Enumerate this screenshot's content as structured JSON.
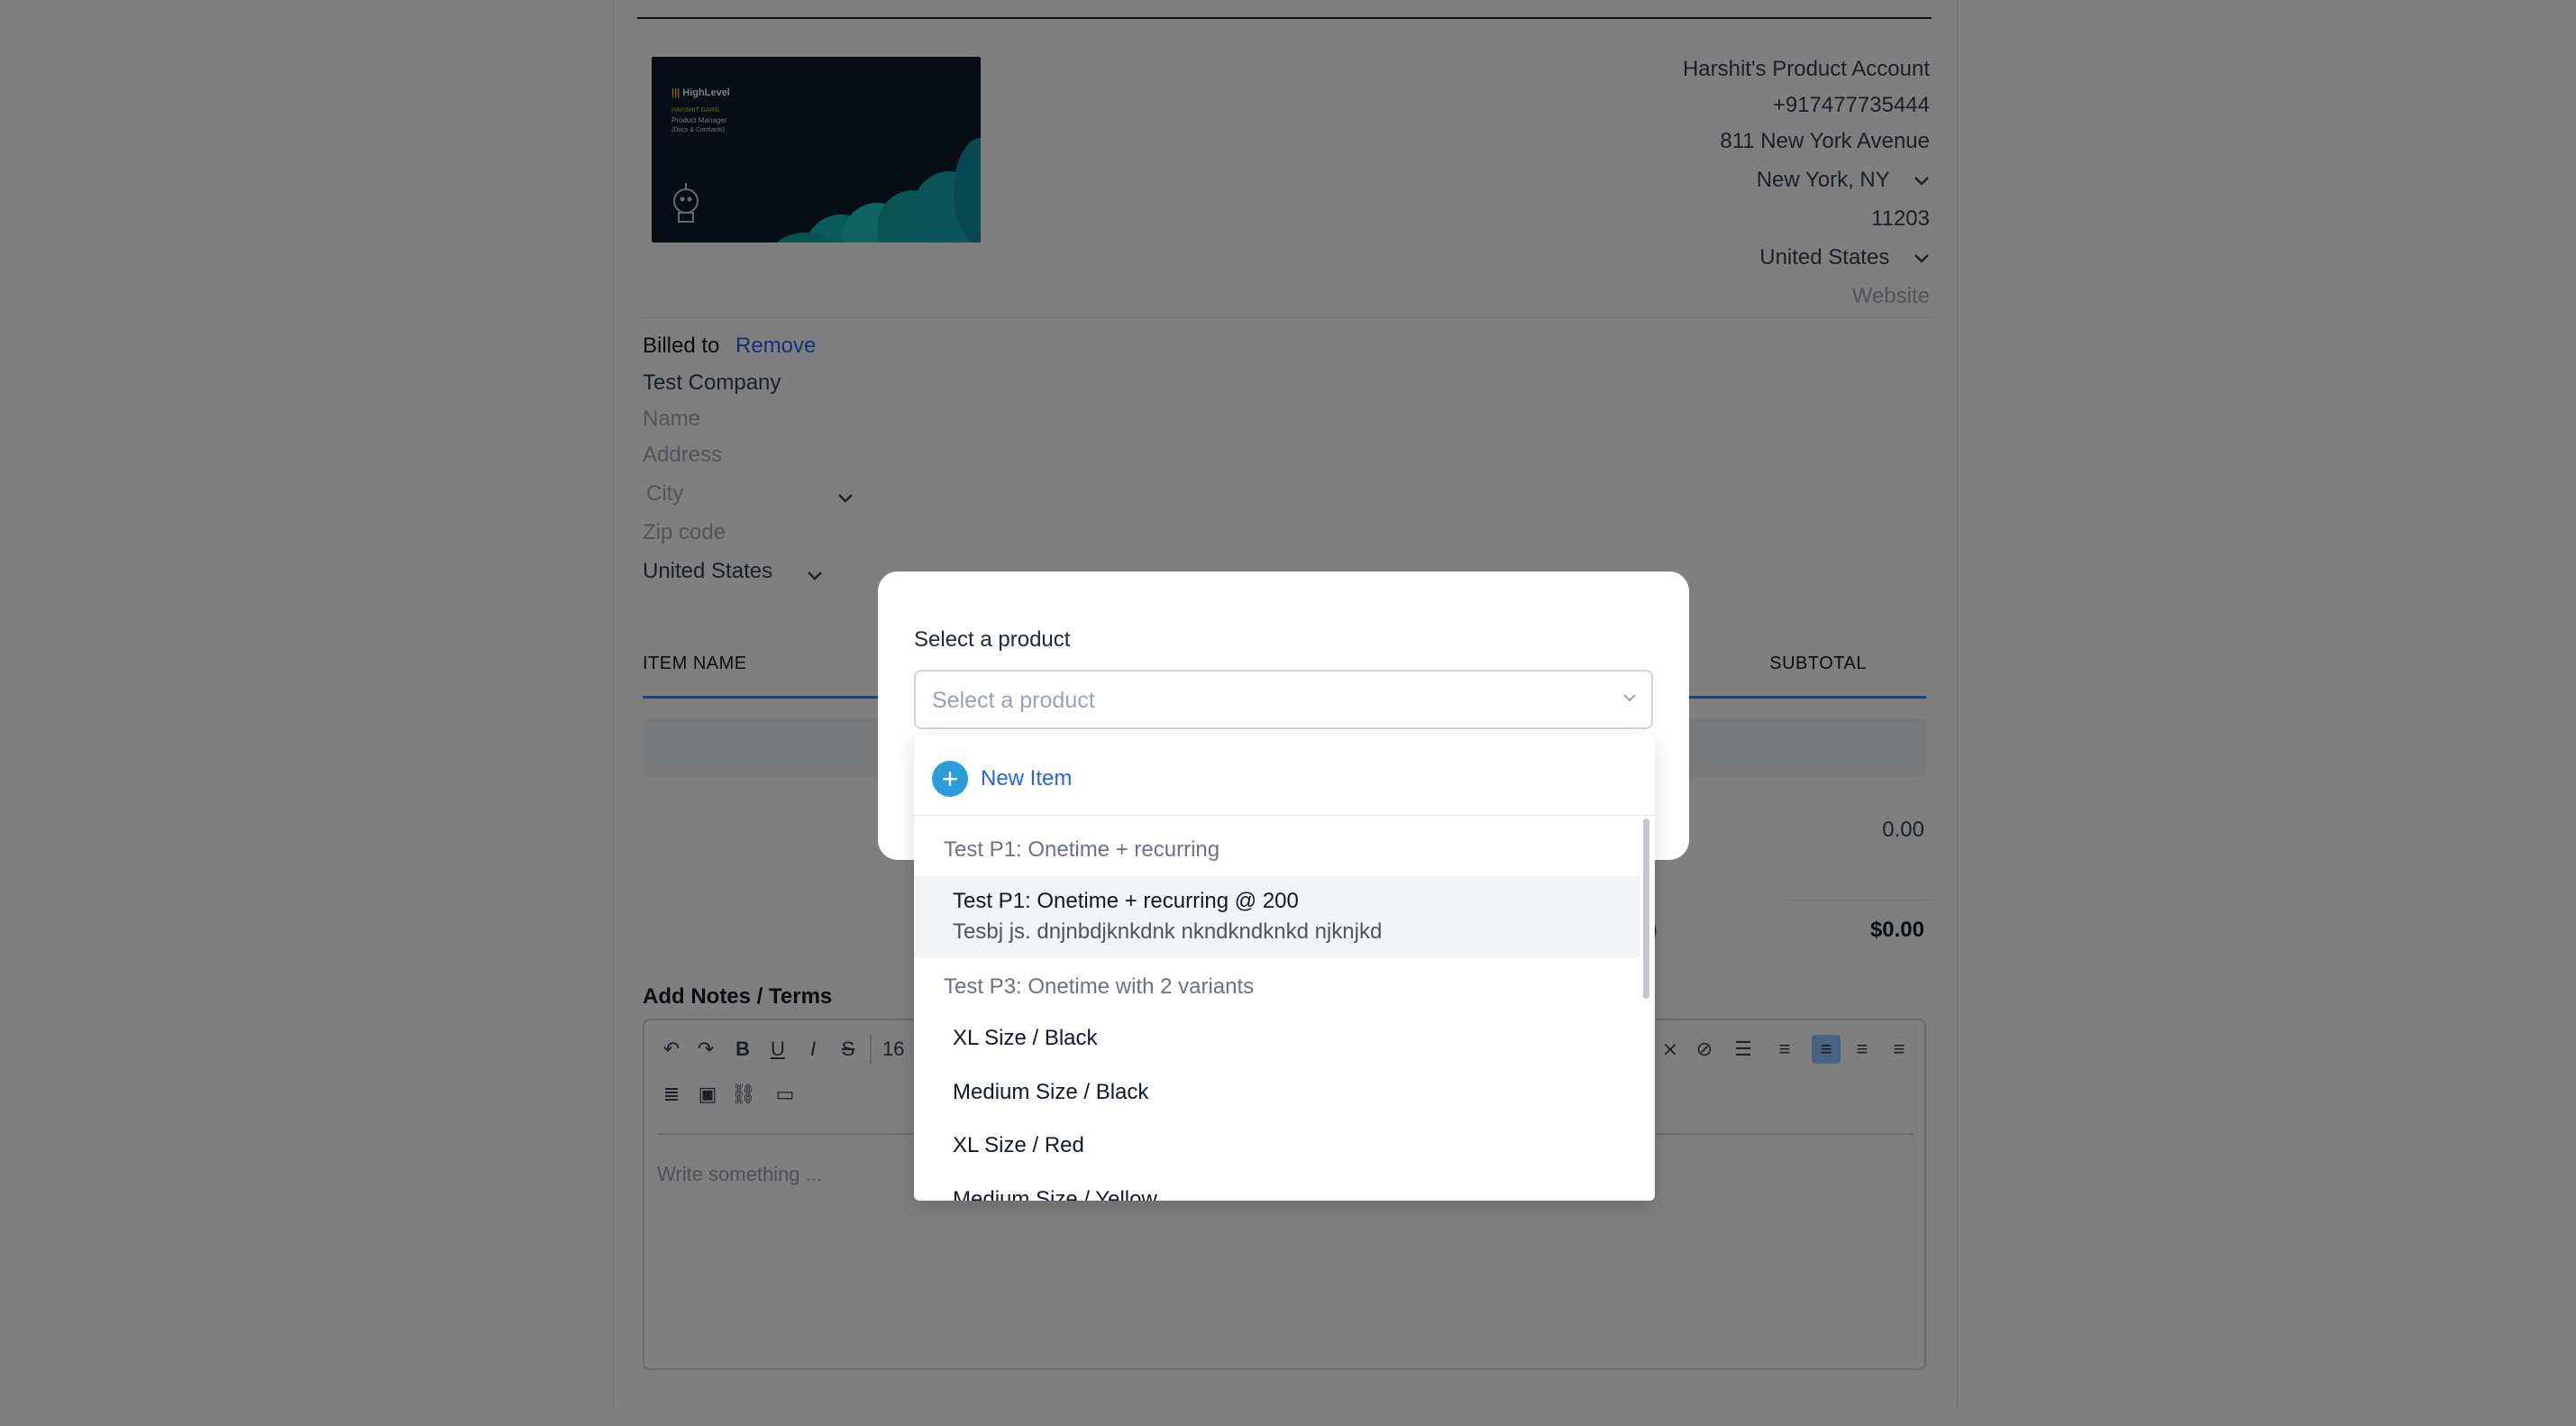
{
  "sender": {
    "business_name": "Harshit's Product Account",
    "phone": "+917477735444",
    "address": "811 New York Avenue",
    "city_state": "New York,  NY",
    "zip": "11203",
    "country": "United States",
    "website_placeholder": "Website"
  },
  "logo": {
    "brand": "HighLevel",
    "line1": "HARSHIT GARG",
    "line2": "Product Manager",
    "line3": "(Docs & Contracts)"
  },
  "billed": {
    "label": "Billed to",
    "remove": "Remove",
    "company": "Test Company",
    "name_placeholder": "Name",
    "address_placeholder": "Address",
    "city_placeholder": "City",
    "zip_placeholder": "Zip code",
    "country": "United States"
  },
  "table": {
    "col_item": "ITEM NAME",
    "col_subtotal": "SUBTOTAL"
  },
  "totals": {
    "subtotal_value": "0.00",
    "total_value": "$0.00",
    "total_paren": ")"
  },
  "notes": {
    "label": "Add Notes / Terms",
    "placeholder": "Write something ...",
    "font_size": "16"
  },
  "modal": {
    "label": "Select a product",
    "placeholder": "Select a product"
  },
  "dropdown": {
    "new_item": "New Item",
    "groups": [
      {
        "label": "Test P1: Onetime + recurring",
        "options": [
          {
            "title": "Test P1: Onetime + recurring @ 200",
            "subtitle": "Tesbj js. dnjnbdjknkdnk nkndkndknkd njknjkd"
          }
        ]
      },
      {
        "label": "Test P3: Onetime with 2 variants",
        "options": [
          {
            "title": "XL Size / Black"
          },
          {
            "title": "Medium Size / Black"
          },
          {
            "title": "XL Size / Red"
          },
          {
            "title": "Medium Size / Yellow"
          }
        ]
      }
    ]
  },
  "colors": {
    "accent": "#2563eb",
    "plus_button": "#2d9cdb",
    "overlay": "rgba(0,0,0,0.5)"
  }
}
